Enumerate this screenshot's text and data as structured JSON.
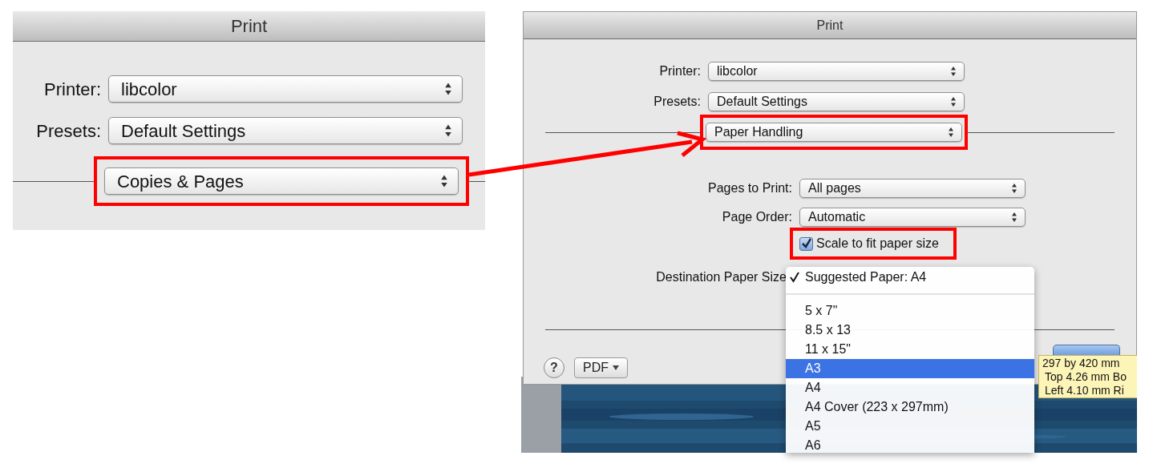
{
  "left_dialog": {
    "title": "Print",
    "rows": [
      {
        "label": "Printer:",
        "value": "libcolor"
      },
      {
        "label": "Presets:",
        "value": "Default Settings"
      }
    ],
    "pane_popup": {
      "value": "Copies & Pages",
      "highlighted": true
    }
  },
  "right_dialog": {
    "title": "Print",
    "rows": [
      {
        "label": "Printer:",
        "value": "libcolor"
      },
      {
        "label": "Presets:",
        "value": "Default Settings"
      }
    ],
    "pane_popup": {
      "value": "Paper Handling",
      "highlighted": true
    },
    "options": [
      {
        "label": "Pages to Print:",
        "value": "All pages"
      },
      {
        "label": "Page Order:",
        "value": "Automatic"
      }
    ],
    "scale_checkbox": {
      "label": "Scale to fit paper size",
      "checked": true,
      "highlighted": true
    },
    "destination_label": "Destination Paper Size",
    "help_button": "?",
    "pdf_button": "PDF"
  },
  "paper_menu": {
    "groups": [
      {
        "items": [
          {
            "label": "Suggested Paper: A4",
            "checked": true,
            "selected": false
          }
        ]
      },
      {
        "items": [
          {
            "label": "5 x 7\"",
            "checked": false,
            "selected": false
          },
          {
            "label": "8.5 x 13",
            "checked": false,
            "selected": false
          },
          {
            "label": "11 x 15\"",
            "checked": false,
            "selected": false
          },
          {
            "label": "A3",
            "checked": false,
            "selected": true
          },
          {
            "label": "A4",
            "checked": false,
            "selected": false
          },
          {
            "label": "A4 Cover (223 x 297mm)",
            "checked": false,
            "selected": false
          },
          {
            "label": "A5",
            "checked": false,
            "selected": false
          },
          {
            "label": "A6",
            "checked": false,
            "selected": false
          }
        ]
      }
    ]
  },
  "tooltip": {
    "lines": [
      "297 by 420 mm",
      "Top 4.26 mm Bo",
      "Left 4.10 mm Ri"
    ]
  }
}
